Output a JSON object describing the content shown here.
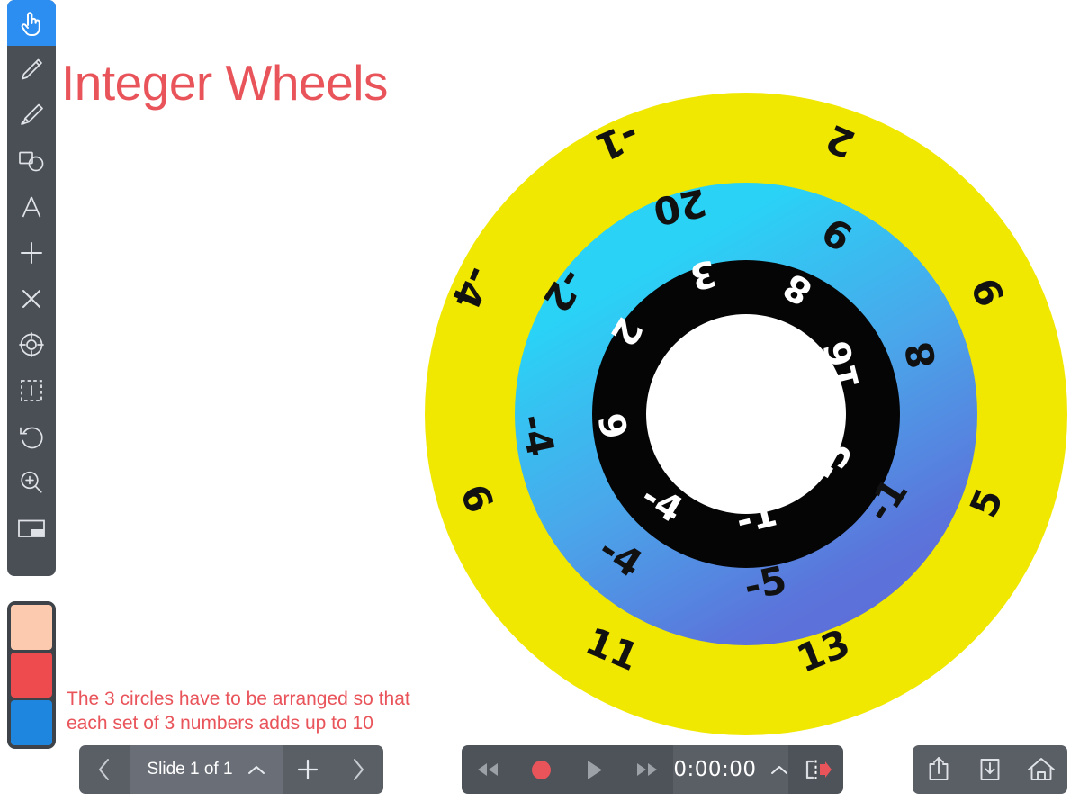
{
  "app": {
    "title": "Integer Wheels"
  },
  "toolbar": {
    "items": [
      {
        "name": "pointer-hand-icon",
        "label": "Pointer",
        "active": true
      },
      {
        "name": "pen-icon",
        "label": "Pen",
        "active": false
      },
      {
        "name": "highlighter-icon",
        "label": "Highlighter",
        "active": false
      },
      {
        "name": "shapes-icon",
        "label": "Shapes",
        "active": false
      },
      {
        "name": "text-icon",
        "label": "Text",
        "active": false
      },
      {
        "name": "plus-icon",
        "label": "Add",
        "active": false
      },
      {
        "name": "close-x-icon",
        "label": "Delete",
        "active": false
      },
      {
        "name": "target-icon",
        "label": "Laser Pointer",
        "active": false
      },
      {
        "name": "select-region-icon",
        "label": "Select",
        "active": false
      },
      {
        "name": "undo-icon",
        "label": "Undo",
        "active": false
      },
      {
        "name": "zoom-in-icon",
        "label": "Zoom",
        "active": false
      },
      {
        "name": "layout-icon",
        "label": "Layout",
        "active": false
      }
    ]
  },
  "palette": {
    "swatches": [
      {
        "name": "swatch-peach",
        "color": "#FCCAAF"
      },
      {
        "name": "swatch-red",
        "color": "#EE4B4F"
      },
      {
        "name": "swatch-blue",
        "color": "#1E86DE"
      }
    ]
  },
  "slide": {
    "caption_line1": "The 3 circles have to be arranged so that",
    "caption_line2": "each set of 3 numbers adds up to 10"
  },
  "slide_nav": {
    "prev_label": "‹",
    "counter_label": "Slide 1 of 1",
    "chevron_label": "^",
    "add_label": "+",
    "next_label": "›"
  },
  "playback": {
    "rewind_label": "◂◂",
    "record_label": "record",
    "play_label": "▶",
    "forward_label": "▸▸",
    "timer_label": "0:00:00",
    "chevron_label": "^",
    "export_label": "export-to-right"
  },
  "actions": {
    "items": [
      {
        "name": "share-button",
        "label": "Share"
      },
      {
        "name": "download-button",
        "label": "Download"
      },
      {
        "name": "home-button",
        "label": "Home"
      }
    ]
  },
  "chart_data": {
    "type": "pie",
    "title": "Integer Wheels",
    "description": "Three concentric rotatable rings of integers; each radial set of 3 numbers must total 10.",
    "target_sum": 10,
    "rings": [
      {
        "name": "outer-ring",
        "color": "#F0E800",
        "text_color": "#111111",
        "radius_pct": 43,
        "values": [
          "-1",
          "2",
          "9",
          "5",
          "13",
          "11",
          "6",
          "-4"
        ],
        "angles": [
          -23,
          23,
          68,
          113,
          158,
          203,
          248,
          293
        ]
      },
      {
        "name": "middle-ring",
        "color": "#2AD2F6",
        "color_end": "#6268D6",
        "text_color": "#111111",
        "radius_pct": 30,
        "values": [
          "20",
          "9",
          "8",
          "-1",
          "-5",
          "-4",
          "-4",
          "-2"
        ],
        "angles": [
          -12,
          33,
          78,
          123,
          168,
          213,
          258,
          303
        ]
      },
      {
        "name": "inner-ring",
        "color": "#050505",
        "text_color": "#FFFFFF",
        "radius_pct": 19.5,
        "values": [
          "3",
          "8",
          "16",
          "-3",
          "-1",
          "-4",
          "9",
          "2"
        ],
        "angles": [
          -14,
          31,
          76,
          121,
          166,
          211,
          256,
          301
        ]
      }
    ],
    "hub_color": "#FFFFFF"
  }
}
